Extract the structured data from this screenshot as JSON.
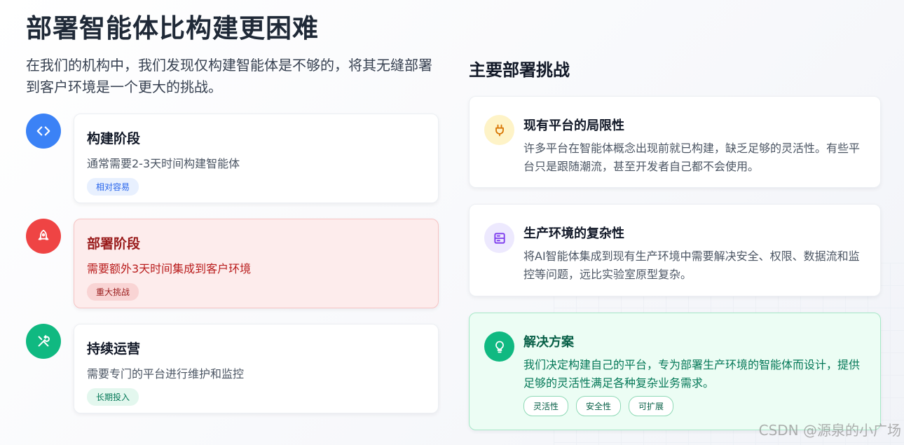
{
  "title": "部署智能体比构建更困难",
  "intro": "在我们的机构中，我们发现仅构建智能体是不够的，将其无缝部署到客户环境是一个更大的挑战。",
  "stages": [
    {
      "title": "构建阶段",
      "desc": "通常需要2-3天时间构建智能体",
      "tag": "相对容易",
      "icon": "code-icon",
      "color": "#3b82f6",
      "tag_bg": "#e8f0fe",
      "tag_color": "#2563eb"
    },
    {
      "title": "部署阶段",
      "desc": "需要额外3天时间集成到客户环境",
      "tag": "重大挑战",
      "icon": "rocket-icon",
      "color": "#ef4444",
      "tag_bg": "#f9d4d4",
      "tag_color": "#991b1b"
    },
    {
      "title": "持续运营",
      "desc": "需要专门的平台进行维护和监控",
      "tag": "长期投入",
      "icon": "tools-icon",
      "color": "#10b981",
      "tag_bg": "#e3f7ee",
      "tag_color": "#047857"
    }
  ],
  "challenges_title": "主要部署挑战",
  "challenges": [
    {
      "title": "现有平台的局限性",
      "desc": "许多平台在智能体概念出现前就已构建，缺乏足够的灵活性。有些平台只是跟随潮流，甚至开发者自己都不会使用。",
      "icon": "plug-icon",
      "icon_bg": "#fef3c7",
      "icon_color": "#d97706"
    },
    {
      "title": "生产环境的复杂性",
      "desc": "将AI智能体集成到现有生产环境中需要解决安全、权限、数据流和监控等问题，远比实验室原型复杂。",
      "icon": "server-icon",
      "icon_bg": "#ede9fe",
      "icon_color": "#7c3aed"
    }
  ],
  "solution": {
    "title": "解决方案",
    "desc": "我们决定构建自己的平台，专为部署生产环境的智能体而设计，提供足够的灵活性满足各种复杂业务需求。",
    "icon": "lightbulb-icon",
    "icon_bg": "#10b981",
    "tags": [
      "灵活性",
      "安全性",
      "可扩展"
    ]
  },
  "watermark": "CSDN @源泉的小广场"
}
